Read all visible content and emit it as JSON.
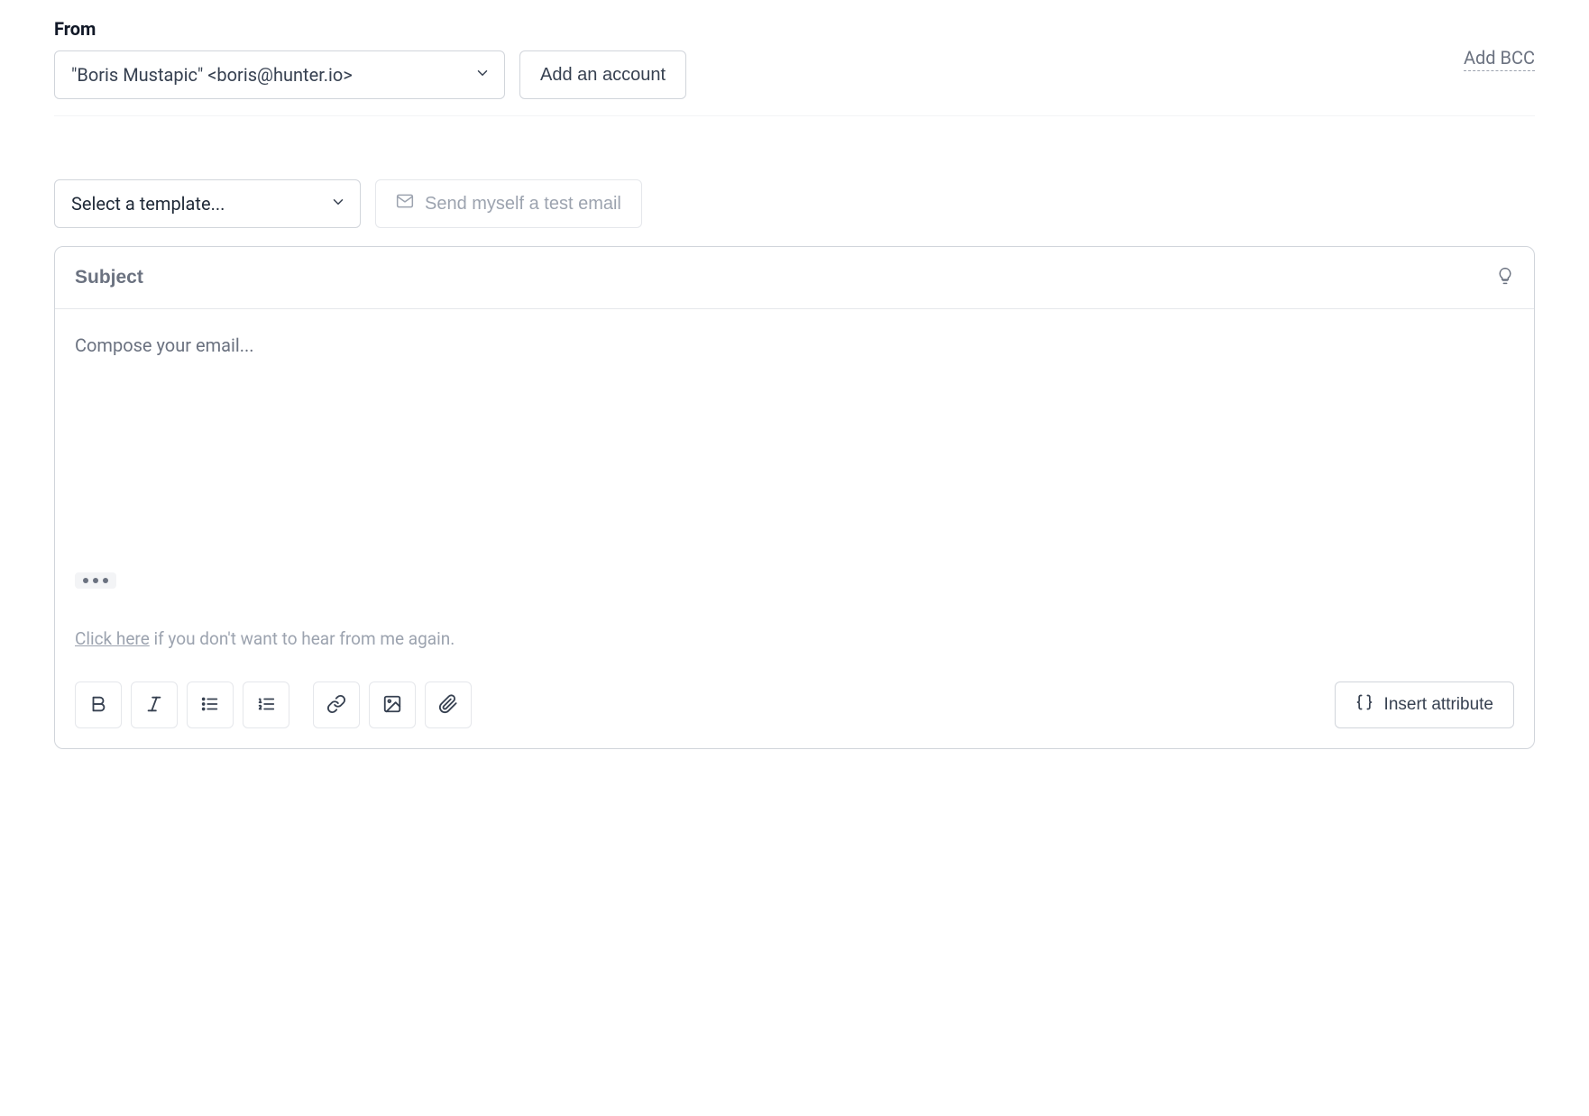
{
  "from": {
    "label": "From",
    "selected": "\"Boris Mustapic\" <boris@hunter.io>",
    "add_account": "Add an account",
    "add_bcc": "Add BCC"
  },
  "template": {
    "placeholder": "Select a template...",
    "test_email": "Send myself a test email"
  },
  "editor": {
    "subject_placeholder": "Subject",
    "compose_placeholder": "Compose your email...",
    "unsubscribe_link": "Click here",
    "unsubscribe_rest": " if you don't want to hear from me again."
  },
  "toolbar": {
    "insert_attribute": "Insert attribute"
  }
}
